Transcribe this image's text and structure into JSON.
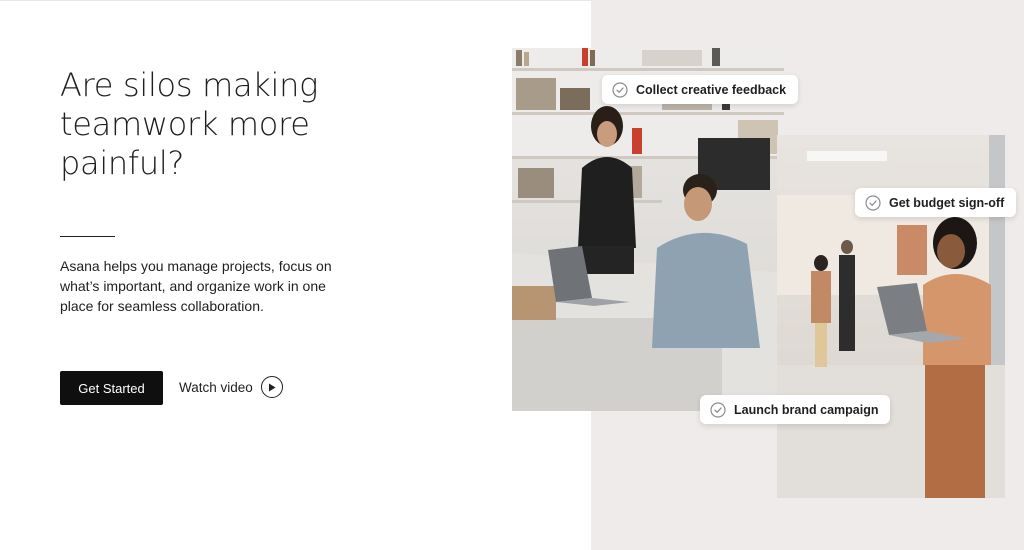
{
  "hero": {
    "headline": "Are silos making teamwork more painful?",
    "description": "Asana helps you manage projects, focus on what’s important, and organize work in one place for seamless collaboration.",
    "primary_cta": "Get Started",
    "secondary_cta": "Watch video",
    "secondary_cta_icon": "play-circle-icon"
  },
  "task_tags": [
    {
      "label": "Collect creative feedback",
      "icon": "check-circle-icon"
    },
    {
      "label": "Get budget sign-off",
      "icon": "check-circle-icon"
    },
    {
      "label": "Launch brand campaign",
      "icon": "check-circle-icon"
    }
  ],
  "colors": {
    "panel_background": "#efebea",
    "button_background": "#0f0f0f",
    "text": "#1e1f21"
  }
}
